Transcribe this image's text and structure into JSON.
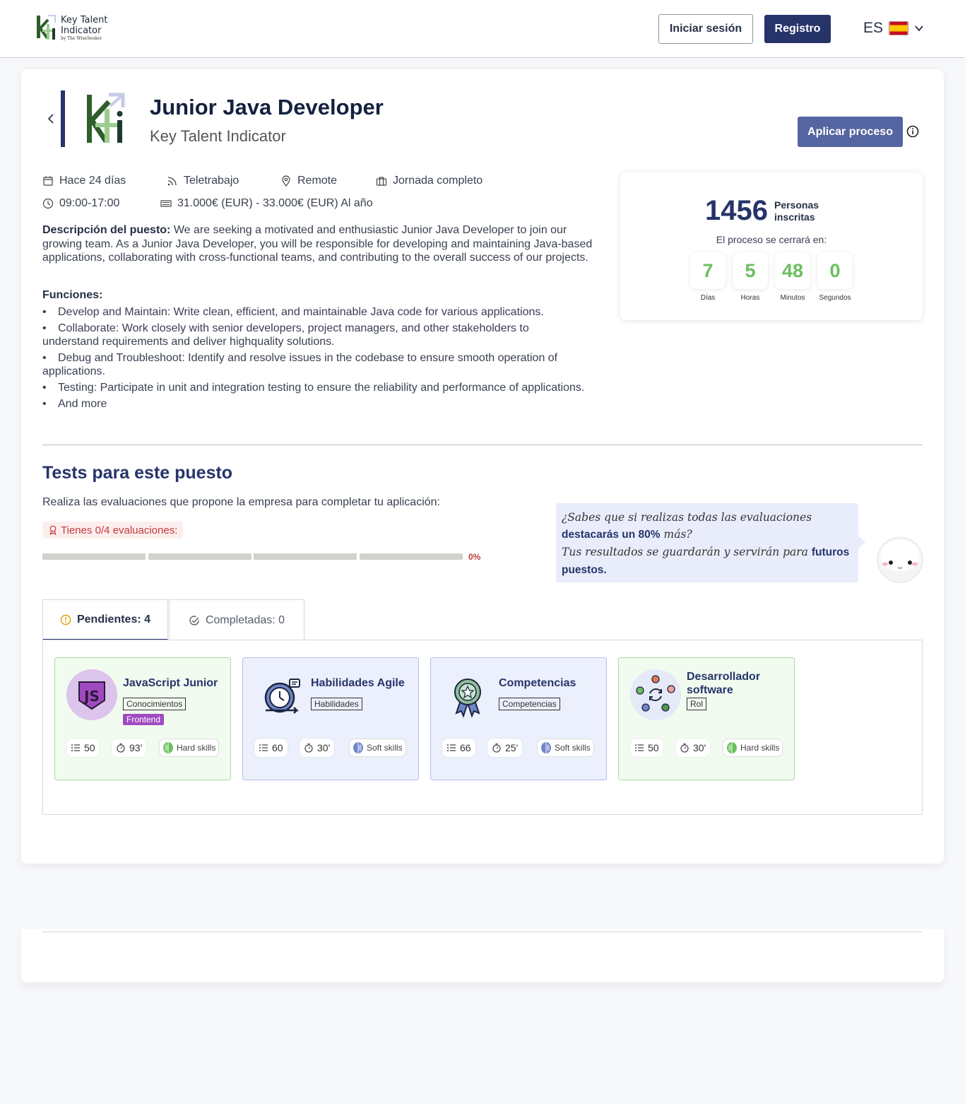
{
  "header": {
    "brand_line1": "Key Talent",
    "brand_line2": "Indicator",
    "brand_sub": "by The WiseSeeker",
    "login": "Iniciar sesión",
    "register": "Registro",
    "lang": "ES"
  },
  "job": {
    "title": "Junior Java Developer",
    "company": "Key Talent Indicator",
    "apply": "Aplicar proceso",
    "posted": "Hace 24 días",
    "mode": "Teletrabajo",
    "location": "Remote",
    "schedule_type": "Jornada completo",
    "hours": "09:00-17:00",
    "salary": "31.000€ (EUR) - 33.000€ (EUR) Al año",
    "desc_label": "Descripción del puesto:",
    "desc_text": " We are seeking a motivated and enthusiastic Junior Java Developer to join our growing team. As a Junior Java Developer, you will be responsible for developing and maintaining Java-based applications, collaborating with cross-functional teams, and contributing to the overall success of our projects.",
    "functions_title": "Funciones:",
    "functions": [
      "Develop and Maintain: Write clean, efficient, and maintainable Java code for various applications.",
      "Collaborate: Work closely with senior developers, project managers, and other stakeholders to understand requirements and deliver highquality solutions.",
      "Debug and Troubleshoot: Identify and resolve issues in the codebase to ensure smooth operation of applications.",
      "Testing: Participate in unit and integration testing to ensure the reliability and performance of applications.",
      "And more"
    ]
  },
  "stats": {
    "count": "1456",
    "count_label": "Personas inscritas",
    "close_text": "El proceso se cerrará en:",
    "countdown": [
      {
        "value": "7",
        "label": "Días"
      },
      {
        "value": "5",
        "label": "Horas"
      },
      {
        "value": "48",
        "label": "Minutos"
      },
      {
        "value": "0",
        "label": "Segundos"
      }
    ]
  },
  "tests": {
    "title": "Tests para este puesto",
    "subtitle": "Realiza las evaluaciones que propone la empresa para completar tu aplicación:",
    "have": "Tienes 0/4 evaluaciones:",
    "progress_pct": "0%",
    "progress_value": 0,
    "tip_part1": "¿Sabes que si realizas todas las evaluaciones ",
    "tip_bold1": "destacarás un 80%",
    "tip_part2": " más?",
    "tip_part3": "Tus resultados se guardarán y servirán para ",
    "tip_bold2": "futuros puestos.",
    "tab_pending": "Pendientes: 4",
    "tab_completed": "Completadas: 0",
    "cards": [
      {
        "name": "JavaScript Junior",
        "tag": "Conocimientos",
        "tag2": "Frontend",
        "questions": "50",
        "minutes": "93'",
        "skill": "Hard skills"
      },
      {
        "name": "Habilidades Agile",
        "tag": "Habilidades",
        "questions": "60",
        "minutes": "30'",
        "skill": "Soft skills"
      },
      {
        "name": "Competencias",
        "tag": "Competencias",
        "questions": "66",
        "minutes": "25'",
        "skill": "Soft skills"
      },
      {
        "name": "Desarrollador software",
        "tag": "Rol",
        "questions": "50",
        "minutes": "30'",
        "skill": "Hard skills"
      }
    ]
  },
  "colors": {
    "primary": "#26346a",
    "accent_green": "#6bbf5e",
    "alert_red": "#c23a3a"
  }
}
